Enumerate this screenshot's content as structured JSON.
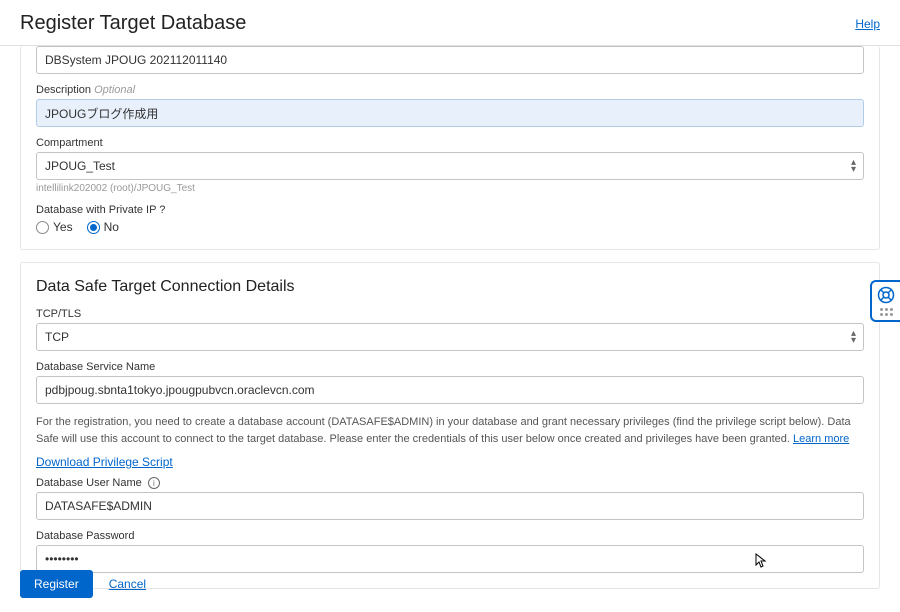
{
  "header": {
    "title": "Register Target Database",
    "help": "Help"
  },
  "section1": {
    "dbname_value": "DBSystem JPOUG 202112011140",
    "description_label": "Description",
    "description_optional": "Optional",
    "description_value": "JPOUGブログ作成用",
    "compartment_label": "Compartment",
    "compartment_value": "JPOUG_Test",
    "compartment_breadcrumb": "intellilink202002 (root)/JPOUG_Test",
    "private_ip_label": "Database with Private IP ?",
    "radio_yes": "Yes",
    "radio_no": "No"
  },
  "section2": {
    "title": "Data Safe Target Connection Details",
    "tcptls_label": "TCP/TLS",
    "tcptls_value": "TCP",
    "service_name_label": "Database Service Name",
    "service_name_value": "pdbjpoug.sbnta1tokyo.jpougpubvcn.oraclevcn.com",
    "hint_text": "For the registration, you need to create a database account (DATASAFE$ADMIN) in your database and grant necessary privileges (find the privilege script below). Data Safe will use this account to connect to the target database. Please enter the credentials of this user below once created and privileges have been granted. ",
    "learn_more": "Learn more",
    "download_script": "Download Privilege Script",
    "db_user_label": "Database User Name",
    "db_user_value": "DATASAFE$ADMIN",
    "db_password_label": "Database Password",
    "db_password_value": "••••••••"
  },
  "footer": {
    "register": "Register",
    "cancel": "Cancel"
  }
}
